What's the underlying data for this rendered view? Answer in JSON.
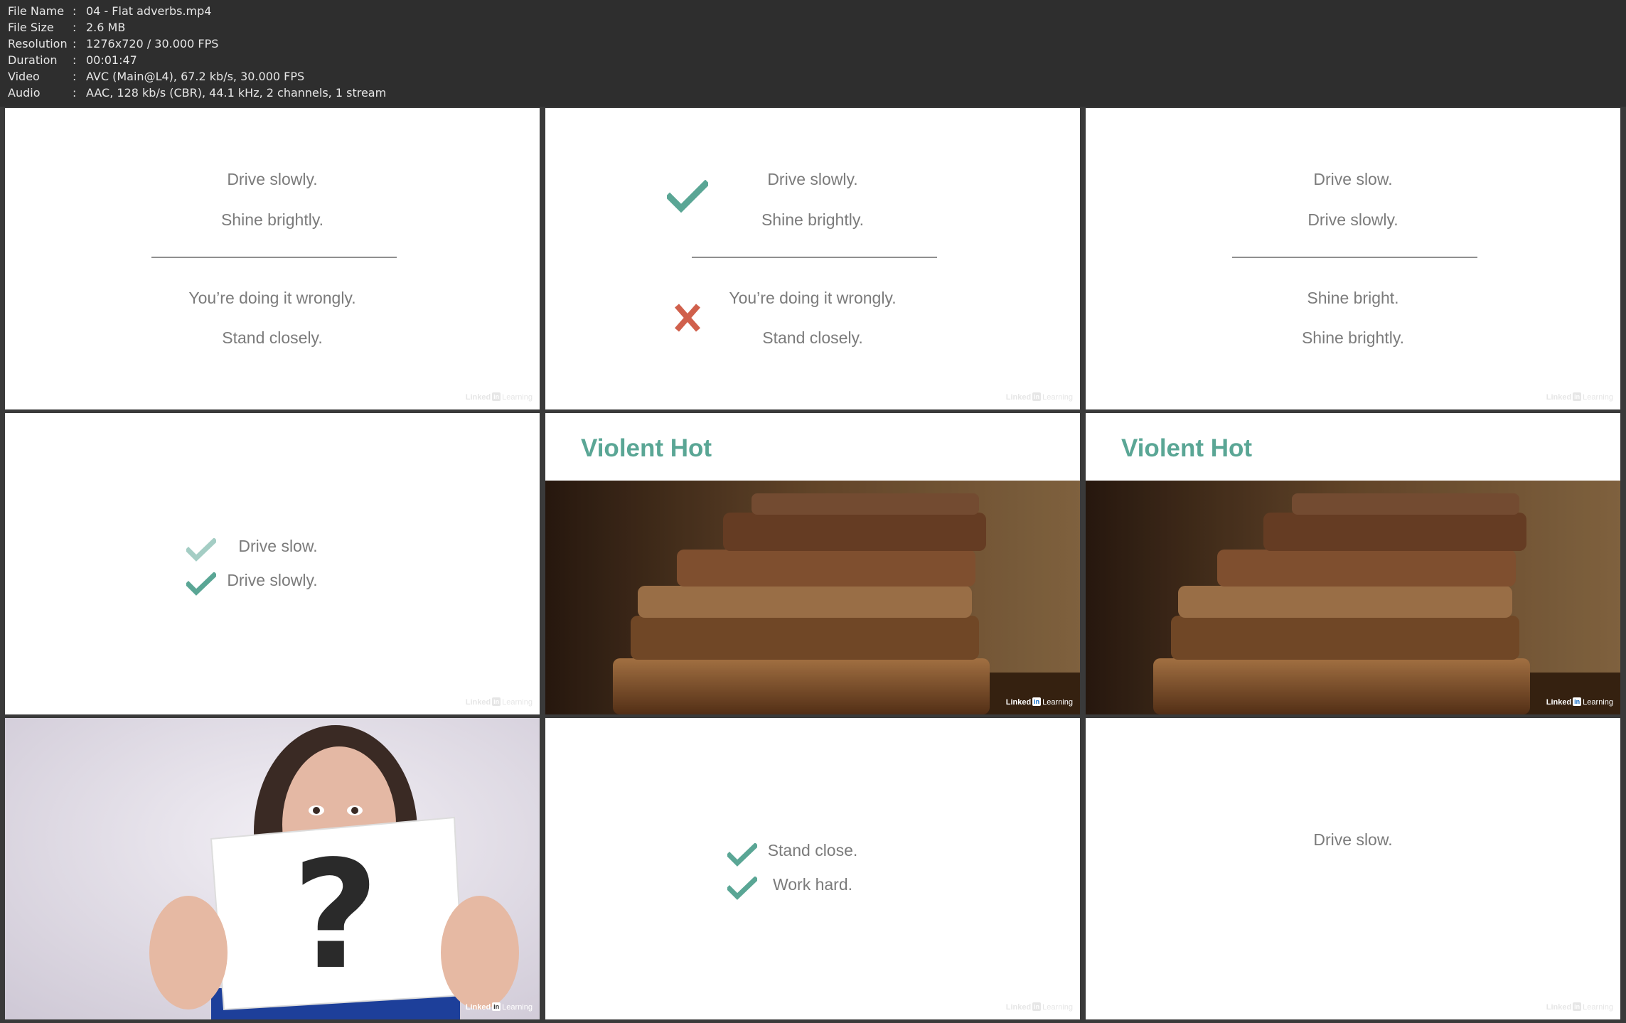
{
  "header": {
    "rows": [
      {
        "key": "File Name",
        "value": "04 - Flat adverbs.mp4"
      },
      {
        "key": "File Size",
        "value": "2.6 MB"
      },
      {
        "key": "Resolution",
        "value": "1276x720 / 30.000 FPS"
      },
      {
        "key": "Duration",
        "value": "00:01:47"
      },
      {
        "key": "Video",
        "value": "AVC (Main@L4), 67.2 kb/s, 30.000 FPS"
      },
      {
        "key": "Audio",
        "value": "AAC, 128 kb/s (CBR), 44.1 kHz, 2 channels, 1 stream"
      }
    ],
    "separator": ":"
  },
  "watermark": {
    "brand": "Linked",
    "in": "in",
    "suffix": "Learning"
  },
  "frames": {
    "f1": {
      "top": [
        "Drive slowly.",
        "Shine brightly."
      ],
      "bottom": [
        "You’re doing it wrongly.",
        "Stand closely."
      ]
    },
    "f2": {
      "top": [
        "Drive slowly.",
        "Shine brightly."
      ],
      "bottom": [
        "You’re doing it wrongly.",
        "Stand closely."
      ],
      "top_mark": "check-icon",
      "bottom_mark": "x-icon"
    },
    "f3": {
      "top": [
        "Drive slow.",
        "Drive slowly."
      ],
      "bottom": [
        "Shine bright.",
        "Shine brightly."
      ]
    },
    "f4": {
      "lines": [
        "Drive slow.",
        "Drive slowly."
      ]
    },
    "f5": {
      "title": "Violent Hot"
    },
    "f6": {
      "title": "Violent Hot"
    },
    "f8": {
      "lines": [
        "Stand close.",
        "Work hard."
      ]
    },
    "f9": {
      "lines": [
        "Drive slow."
      ]
    }
  },
  "colors": {
    "accent": "#5aa695",
    "cross": "#d0604c",
    "text": "#7b7b7b"
  }
}
